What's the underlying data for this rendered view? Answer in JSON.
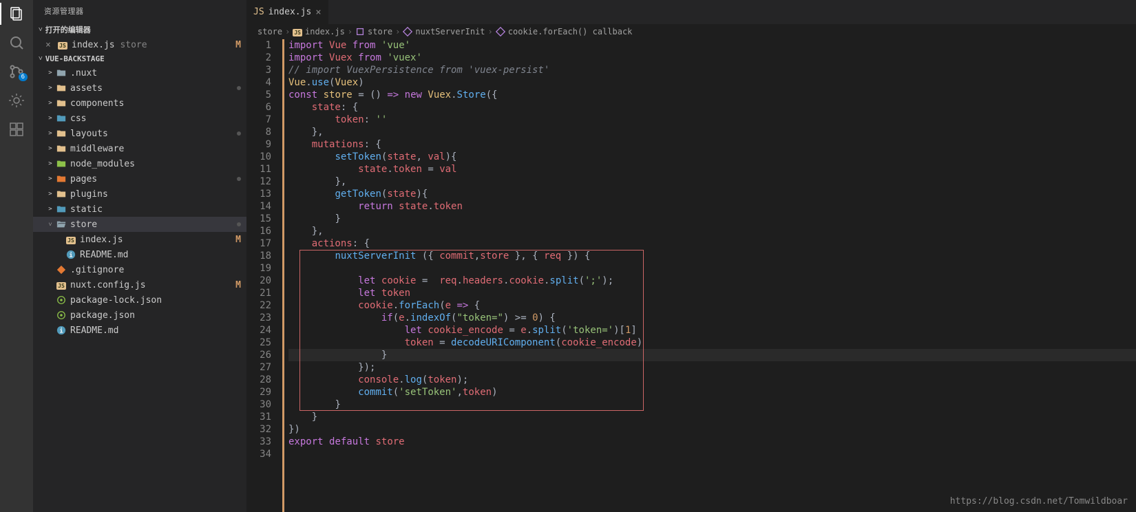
{
  "sidebar": {
    "title": "资源管理器",
    "sections": {
      "openEditors": {
        "label": "打开的编辑器",
        "items": [
          {
            "name": "index.js",
            "hint": "store",
            "status": "M",
            "icon": "js"
          }
        ]
      },
      "project": {
        "label": "VUE-BACKSTAGE",
        "tree": [
          {
            "name": ".nuxt",
            "icon": "folder",
            "chev": ">",
            "indent": 1
          },
          {
            "name": "assets",
            "icon": "folder-y",
            "chev": ">",
            "indent": 1,
            "dot": true
          },
          {
            "name": "components",
            "icon": "folder-y",
            "chev": ">",
            "indent": 1
          },
          {
            "name": "css",
            "icon": "folder-b",
            "chev": ">",
            "indent": 1
          },
          {
            "name": "layouts",
            "icon": "folder-y",
            "chev": ">",
            "indent": 1,
            "dot": true
          },
          {
            "name": "middleware",
            "icon": "folder-y",
            "chev": ">",
            "indent": 1
          },
          {
            "name": "node_modules",
            "icon": "folder-g",
            "chev": ">",
            "indent": 1
          },
          {
            "name": "pages",
            "icon": "folder-o",
            "chev": ">",
            "indent": 1,
            "dot": true
          },
          {
            "name": "plugins",
            "icon": "folder-y",
            "chev": ">",
            "indent": 1
          },
          {
            "name": "static",
            "icon": "folder-b",
            "chev": ">",
            "indent": 1
          },
          {
            "name": "store",
            "icon": "folder-open",
            "chev": "˅",
            "indent": 1,
            "sel": true,
            "dot": true
          },
          {
            "name": "index.js",
            "icon": "js",
            "indent": 2,
            "status": "M"
          },
          {
            "name": "README.md",
            "icon": "info",
            "indent": 2
          },
          {
            "name": ".gitignore",
            "icon": "git",
            "indent": 1
          },
          {
            "name": "nuxt.config.js",
            "icon": "js",
            "indent": 1,
            "status": "M"
          },
          {
            "name": "package-lock.json",
            "icon": "npm",
            "indent": 1
          },
          {
            "name": "package.json",
            "icon": "npm",
            "indent": 1
          },
          {
            "name": "README.md",
            "icon": "info",
            "indent": 1
          }
        ]
      }
    }
  },
  "tabs": [
    {
      "name": "index.js",
      "icon": "js",
      "active": true
    }
  ],
  "breadcrumbs": [
    {
      "label": "store",
      "icon": ""
    },
    {
      "label": "index.js",
      "icon": "js"
    },
    {
      "label": "store",
      "icon": "pkg"
    },
    {
      "label": "nuxtServerInit",
      "icon": "method"
    },
    {
      "label": "cookie.forEach() callback",
      "icon": "method"
    }
  ],
  "code": {
    "currentLine": 26,
    "highlightBox": {
      "startLine": 18,
      "endLine": 30
    },
    "lines": [
      {
        "n": 1,
        "t": [
          [
            "k1",
            "import"
          ],
          [
            "w",
            " "
          ],
          [
            "v",
            "Vue"
          ],
          [
            "w",
            " "
          ],
          [
            "k1",
            "from"
          ],
          [
            "w",
            " "
          ],
          [
            "s",
            "'vue'"
          ]
        ]
      },
      {
        "n": 2,
        "t": [
          [
            "k1",
            "import"
          ],
          [
            "w",
            " "
          ],
          [
            "v",
            "Vuex"
          ],
          [
            "w",
            " "
          ],
          [
            "k1",
            "from"
          ],
          [
            "w",
            " "
          ],
          [
            "s",
            "'vuex'"
          ]
        ]
      },
      {
        "n": 3,
        "t": [
          [
            "c",
            "// import VuexPersistence from 'vuex-persist'"
          ]
        ]
      },
      {
        "n": 4,
        "t": [
          [
            "k3",
            "Vue"
          ],
          [
            "p",
            "."
          ],
          [
            "fn",
            "use"
          ],
          [
            "p",
            "("
          ],
          [
            "k3",
            "Vuex"
          ],
          [
            "p",
            ")"
          ]
        ]
      },
      {
        "n": 5,
        "t": [
          [
            "k1",
            "const"
          ],
          [
            "w",
            " "
          ],
          [
            "k3",
            "store"
          ],
          [
            "w",
            " "
          ],
          [
            "p",
            "="
          ],
          [
            "w",
            " "
          ],
          [
            "p",
            "()"
          ],
          [
            "w",
            " "
          ],
          [
            "k1",
            "=>"
          ],
          [
            "w",
            " "
          ],
          [
            "k1",
            "new"
          ],
          [
            "w",
            " "
          ],
          [
            "k3",
            "Vuex"
          ],
          [
            "p",
            "."
          ],
          [
            "fn",
            "Store"
          ],
          [
            "p",
            "({"
          ]
        ]
      },
      {
        "n": 6,
        "t": [
          [
            "w",
            "    "
          ],
          [
            "v",
            "state"
          ],
          [
            "p",
            ": {"
          ]
        ]
      },
      {
        "n": 7,
        "t": [
          [
            "w",
            "        "
          ],
          [
            "v",
            "token"
          ],
          [
            "p",
            ": "
          ],
          [
            "s",
            "''"
          ]
        ]
      },
      {
        "n": 8,
        "t": [
          [
            "w",
            "    "
          ],
          [
            "p",
            "},"
          ]
        ]
      },
      {
        "n": 9,
        "t": [
          [
            "w",
            "    "
          ],
          [
            "v",
            "mutations"
          ],
          [
            "p",
            ": {"
          ]
        ]
      },
      {
        "n": 10,
        "t": [
          [
            "w",
            "        "
          ],
          [
            "fn",
            "setToken"
          ],
          [
            "p",
            "("
          ],
          [
            "v",
            "state"
          ],
          [
            "p",
            ", "
          ],
          [
            "v",
            "val"
          ],
          [
            "p",
            "){"
          ]
        ]
      },
      {
        "n": 11,
        "t": [
          [
            "w",
            "            "
          ],
          [
            "v",
            "state"
          ],
          [
            "p",
            "."
          ],
          [
            "v",
            "token"
          ],
          [
            "w",
            " "
          ],
          [
            "p",
            "="
          ],
          [
            "w",
            " "
          ],
          [
            "v",
            "val"
          ]
        ]
      },
      {
        "n": 12,
        "t": [
          [
            "w",
            "        "
          ],
          [
            "p",
            "},"
          ]
        ]
      },
      {
        "n": 13,
        "t": [
          [
            "w",
            "        "
          ],
          [
            "fn",
            "getToken"
          ],
          [
            "p",
            "("
          ],
          [
            "v",
            "state"
          ],
          [
            "p",
            "){"
          ]
        ]
      },
      {
        "n": 14,
        "t": [
          [
            "w",
            "            "
          ],
          [
            "k1",
            "return"
          ],
          [
            "w",
            " "
          ],
          [
            "v",
            "state"
          ],
          [
            "p",
            "."
          ],
          [
            "v",
            "token"
          ]
        ]
      },
      {
        "n": 15,
        "t": [
          [
            "w",
            "        "
          ],
          [
            "p",
            "}"
          ]
        ]
      },
      {
        "n": 16,
        "t": [
          [
            "w",
            "    "
          ],
          [
            "p",
            "},"
          ]
        ]
      },
      {
        "n": 17,
        "t": [
          [
            "w",
            "    "
          ],
          [
            "v",
            "actions"
          ],
          [
            "p",
            ": {"
          ]
        ]
      },
      {
        "n": 18,
        "t": [
          [
            "w",
            "        "
          ],
          [
            "fn",
            "nuxtServerInit"
          ],
          [
            "w",
            " "
          ],
          [
            "p",
            "({ "
          ],
          [
            "v",
            "commit"
          ],
          [
            "p",
            ","
          ],
          [
            "v",
            "store"
          ],
          [
            "p",
            " }, { "
          ],
          [
            "v",
            "req"
          ],
          [
            "p",
            " }) {"
          ]
        ]
      },
      {
        "n": 19,
        "t": [
          [
            "w",
            ""
          ]
        ]
      },
      {
        "n": 20,
        "t": [
          [
            "w",
            "            "
          ],
          [
            "k1",
            "let"
          ],
          [
            "w",
            " "
          ],
          [
            "v",
            "cookie"
          ],
          [
            "w",
            " "
          ],
          [
            "p",
            "="
          ],
          [
            "w",
            "  "
          ],
          [
            "v",
            "req"
          ],
          [
            "p",
            "."
          ],
          [
            "v",
            "headers"
          ],
          [
            "p",
            "."
          ],
          [
            "v",
            "cookie"
          ],
          [
            "p",
            "."
          ],
          [
            "fn",
            "split"
          ],
          [
            "p",
            "("
          ],
          [
            "s",
            "';'"
          ],
          [
            "p",
            ");"
          ]
        ]
      },
      {
        "n": 21,
        "t": [
          [
            "w",
            "            "
          ],
          [
            "k1",
            "let"
          ],
          [
            "w",
            " "
          ],
          [
            "v",
            "token"
          ]
        ]
      },
      {
        "n": 22,
        "t": [
          [
            "w",
            "            "
          ],
          [
            "v",
            "cookie"
          ],
          [
            "p",
            "."
          ],
          [
            "fn",
            "forEach"
          ],
          [
            "p",
            "("
          ],
          [
            "v",
            "e"
          ],
          [
            "w",
            " "
          ],
          [
            "k1",
            "=>"
          ],
          [
            "w",
            " "
          ],
          [
            "p",
            "{"
          ]
        ]
      },
      {
        "n": 23,
        "t": [
          [
            "w",
            "                "
          ],
          [
            "k1",
            "if"
          ],
          [
            "p",
            "("
          ],
          [
            "v",
            "e"
          ],
          [
            "p",
            "."
          ],
          [
            "fn",
            "indexOf"
          ],
          [
            "p",
            "("
          ],
          [
            "s",
            "\"token=\""
          ],
          [
            "p",
            ") "
          ],
          [
            "p",
            ">="
          ],
          [
            "w",
            " "
          ],
          [
            "d",
            "0"
          ],
          [
            "p",
            ") "
          ],
          [
            "p",
            "{"
          ]
        ]
      },
      {
        "n": 24,
        "t": [
          [
            "w",
            "                    "
          ],
          [
            "k1",
            "let"
          ],
          [
            "w",
            " "
          ],
          [
            "v",
            "cookie_encode"
          ],
          [
            "w",
            " "
          ],
          [
            "p",
            "="
          ],
          [
            "w",
            " "
          ],
          [
            "v",
            "e"
          ],
          [
            "p",
            "."
          ],
          [
            "fn",
            "split"
          ],
          [
            "p",
            "("
          ],
          [
            "s",
            "'token='"
          ],
          [
            "p",
            ")["
          ],
          [
            "d",
            "1"
          ],
          [
            "p",
            "]"
          ]
        ]
      },
      {
        "n": 25,
        "t": [
          [
            "w",
            "                    "
          ],
          [
            "v",
            "token"
          ],
          [
            "w",
            " "
          ],
          [
            "p",
            "="
          ],
          [
            "w",
            " "
          ],
          [
            "fn",
            "decodeURIComponent"
          ],
          [
            "p",
            "("
          ],
          [
            "v",
            "cookie_encode"
          ],
          [
            "p",
            ")"
          ]
        ]
      },
      {
        "n": 26,
        "t": [
          [
            "w",
            "                "
          ],
          [
            "p",
            "}"
          ]
        ]
      },
      {
        "n": 27,
        "t": [
          [
            "w",
            "            "
          ],
          [
            "p",
            "});"
          ]
        ]
      },
      {
        "n": 28,
        "t": [
          [
            "w",
            "            "
          ],
          [
            "v",
            "console"
          ],
          [
            "p",
            "."
          ],
          [
            "fn",
            "log"
          ],
          [
            "p",
            "("
          ],
          [
            "v",
            "token"
          ],
          [
            "p",
            ");"
          ]
        ]
      },
      {
        "n": 29,
        "t": [
          [
            "w",
            "            "
          ],
          [
            "fn",
            "commit"
          ],
          [
            "p",
            "("
          ],
          [
            "s",
            "'setToken'"
          ],
          [
            "p",
            ","
          ],
          [
            "v",
            "token"
          ],
          [
            "p",
            ")"
          ]
        ]
      },
      {
        "n": 30,
        "t": [
          [
            "w",
            "        "
          ],
          [
            "p",
            "}"
          ]
        ]
      },
      {
        "n": 31,
        "t": [
          [
            "w",
            "    "
          ],
          [
            "p",
            "}"
          ]
        ]
      },
      {
        "n": 32,
        "t": [
          [
            "p",
            "})"
          ]
        ]
      },
      {
        "n": 33,
        "t": [
          [
            "k1",
            "export"
          ],
          [
            "w",
            " "
          ],
          [
            "k1",
            "default"
          ],
          [
            "w",
            " "
          ],
          [
            "v",
            "store"
          ]
        ]
      },
      {
        "n": 34,
        "t": [
          [
            "w",
            ""
          ]
        ]
      }
    ]
  },
  "watermark": "https://blog.csdn.net/Tomwildboar",
  "activityBadge": "6"
}
